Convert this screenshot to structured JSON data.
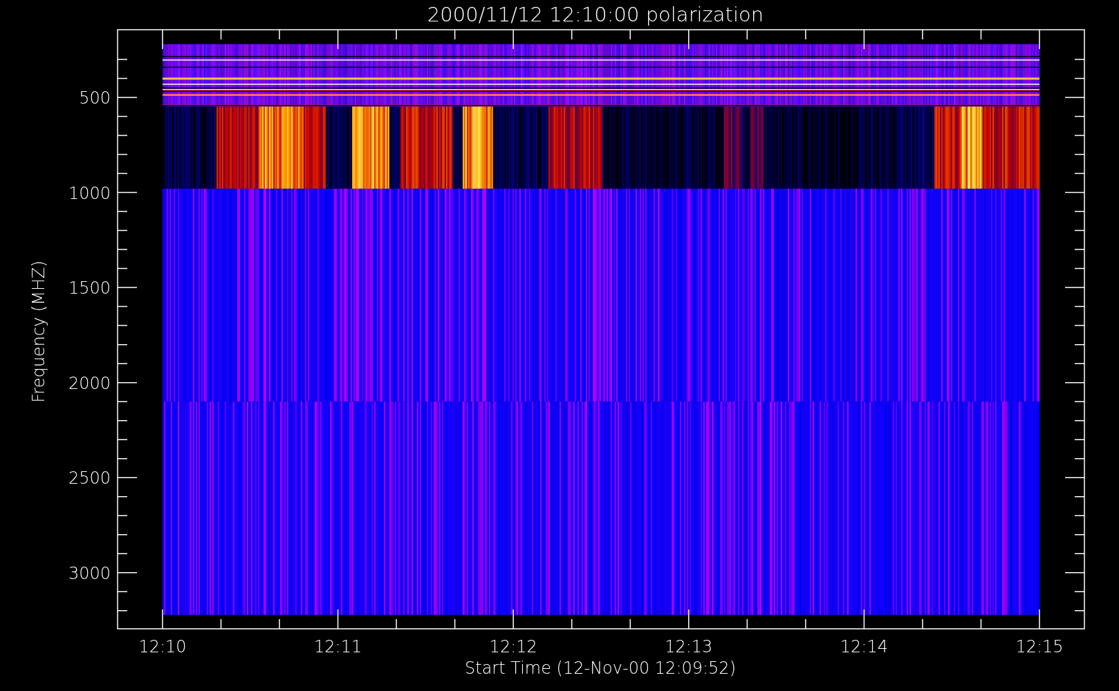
{
  "plot": {
    "title": "2000/11/12 12:10:00 polarization",
    "ylabel": "Frequency (MHZ)",
    "xlabel": "Start Time (12-Nov-00 12:09:52)",
    "yticks": [
      "500",
      "1000",
      "1500",
      "2000",
      "2500",
      "3000"
    ],
    "xticks": [
      "12:10",
      "12:11",
      "12:12",
      "12:13",
      "12:14",
      "12:15"
    ]
  }
}
